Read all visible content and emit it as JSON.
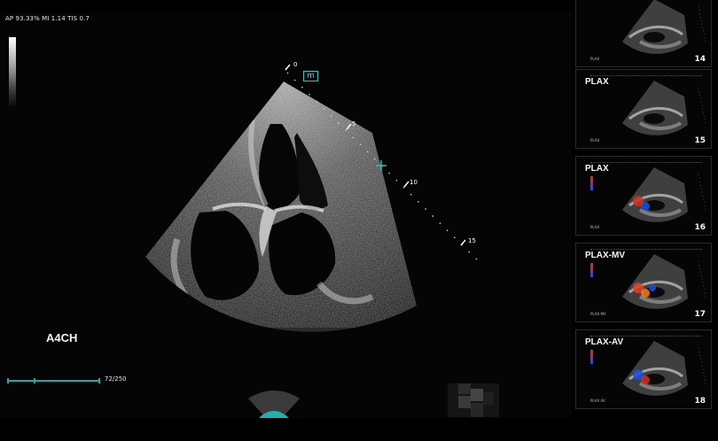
{
  "status": {
    "acoustic_readout": "AP 93.33%  MI 1.14  TIS 0.7"
  },
  "image": {
    "orientation_marker": "m",
    "view_label": "A4CH",
    "depth_scale": [
      "0",
      "5",
      "10",
      "15"
    ]
  },
  "cine": {
    "frame_counter": "72/250",
    "progress": 0.288
  },
  "thumbnails": [
    {
      "title": "",
      "number": "14",
      "footer": "PLAX",
      "colors": []
    },
    {
      "title": "PLAX",
      "number": "15",
      "footer": "PLAX",
      "colors": []
    },
    {
      "title": "PLAX",
      "number": "16",
      "footer": "PLAX",
      "colors": [
        "#d03020",
        "#1d4fd8"
      ]
    },
    {
      "title": "PLAX-MV",
      "number": "17",
      "footer": "PLAX MV",
      "colors": [
        "#e04020",
        "#ff7a1a",
        "#1d4fd8"
      ]
    },
    {
      "title": "PLAX-AV",
      "number": "18",
      "footer": "PLAX AV",
      "colors": [
        "#1d4fd8",
        "#d03020"
      ]
    }
  ],
  "colors": {
    "accent_teal": "#1fa9a9",
    "marker_teal": "#27c5c5"
  },
  "icons": {
    "probe": "probe-dome-icon",
    "gray_scale": "gray-scale-bar"
  }
}
